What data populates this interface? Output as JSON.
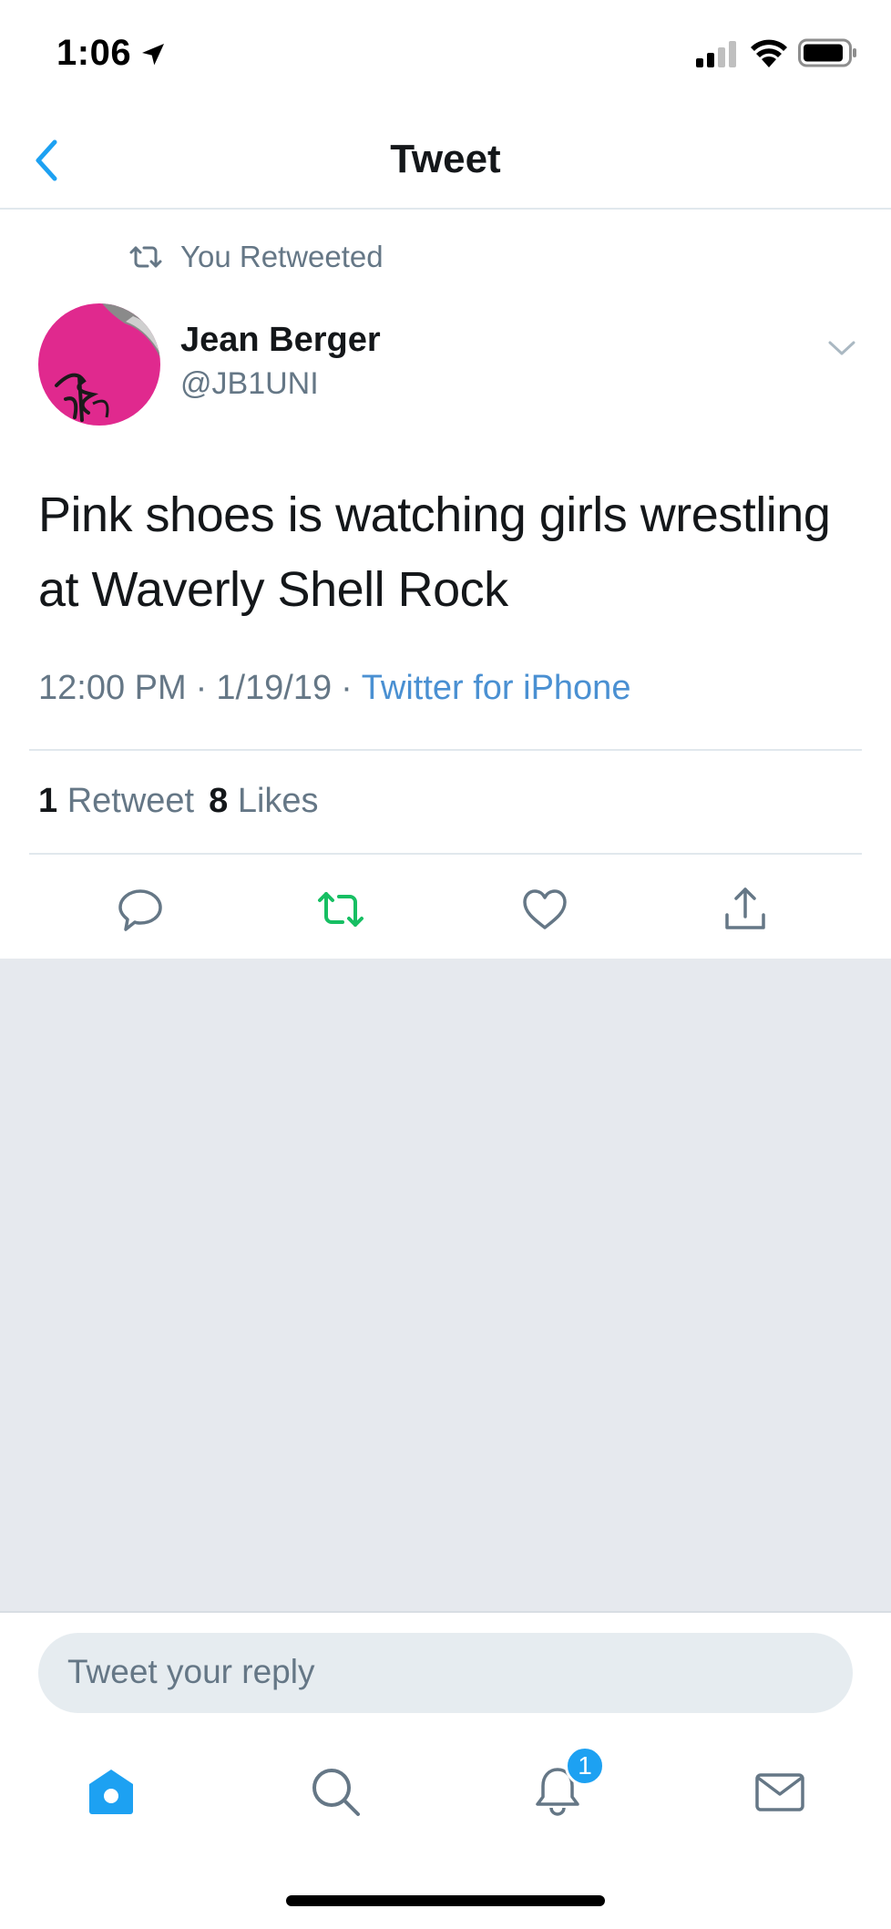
{
  "status_bar": {
    "time": "1:06",
    "icons": [
      "location-arrow-icon",
      "cellular-signal-icon",
      "wifi-icon",
      "battery-icon"
    ]
  },
  "nav": {
    "title": "Tweet",
    "back_icon": "chevron-left-icon"
  },
  "retweet_context": {
    "icon": "retweet-icon",
    "text": "You Retweeted"
  },
  "tweet": {
    "author_name": "Jean Berger",
    "author_handle": "@JB1UNI",
    "text": "Pink shoes is watching girls wrestling at Waverly Shell Rock",
    "time": "12:00 PM",
    "date": "1/19/19",
    "separator": "·",
    "source": "Twitter for iPhone",
    "retweet_count": "1",
    "retweet_label": "Retweet",
    "like_count": "8",
    "like_label": "Likes"
  },
  "actions": [
    {
      "name": "reply-icon"
    },
    {
      "name": "retweet-icon",
      "active": true
    },
    {
      "name": "like-icon"
    },
    {
      "name": "share-icon"
    }
  ],
  "reply": {
    "placeholder": "Tweet your reply"
  },
  "tab_bar": {
    "tabs": [
      "home-icon",
      "search-icon",
      "notifications-icon",
      "messages-icon"
    ],
    "notification_badge": "1"
  },
  "colors": {
    "accent": "#1da1f2",
    "link": "#4a90d2",
    "retweet_active": "#17bf63",
    "secondary_text": "#657786",
    "background_grey": "#e6e9ee"
  }
}
